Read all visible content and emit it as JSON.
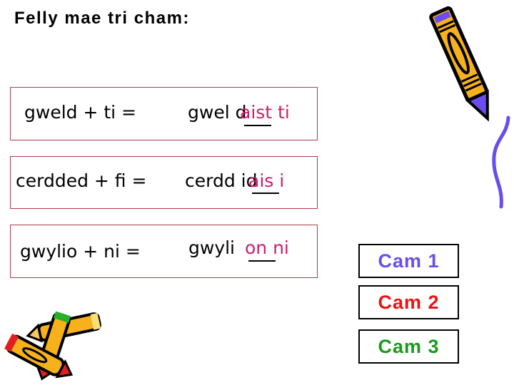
{
  "title": "Felly mae tri cham:",
  "equations": [
    {
      "left": "gweld + ti =",
      "stem": "gwel d",
      "ending": "aist ti"
    },
    {
      "left": "cerdded + fi =",
      "stem": "cerdd id",
      "ending": "ais i"
    },
    {
      "left": "gwylio + ni =",
      "stem": "gwyli",
      "ending": "on ni"
    }
  ],
  "steps": [
    {
      "label": "Cam 1",
      "color": "#6a4cf0"
    },
    {
      "label": "Cam 2",
      "color": "#ee1111"
    },
    {
      "label": "Cam 3",
      "color": "#1a9a1a"
    }
  ],
  "colors": {
    "answer": "#cc1f6a",
    "box_border": "#b03a48"
  }
}
